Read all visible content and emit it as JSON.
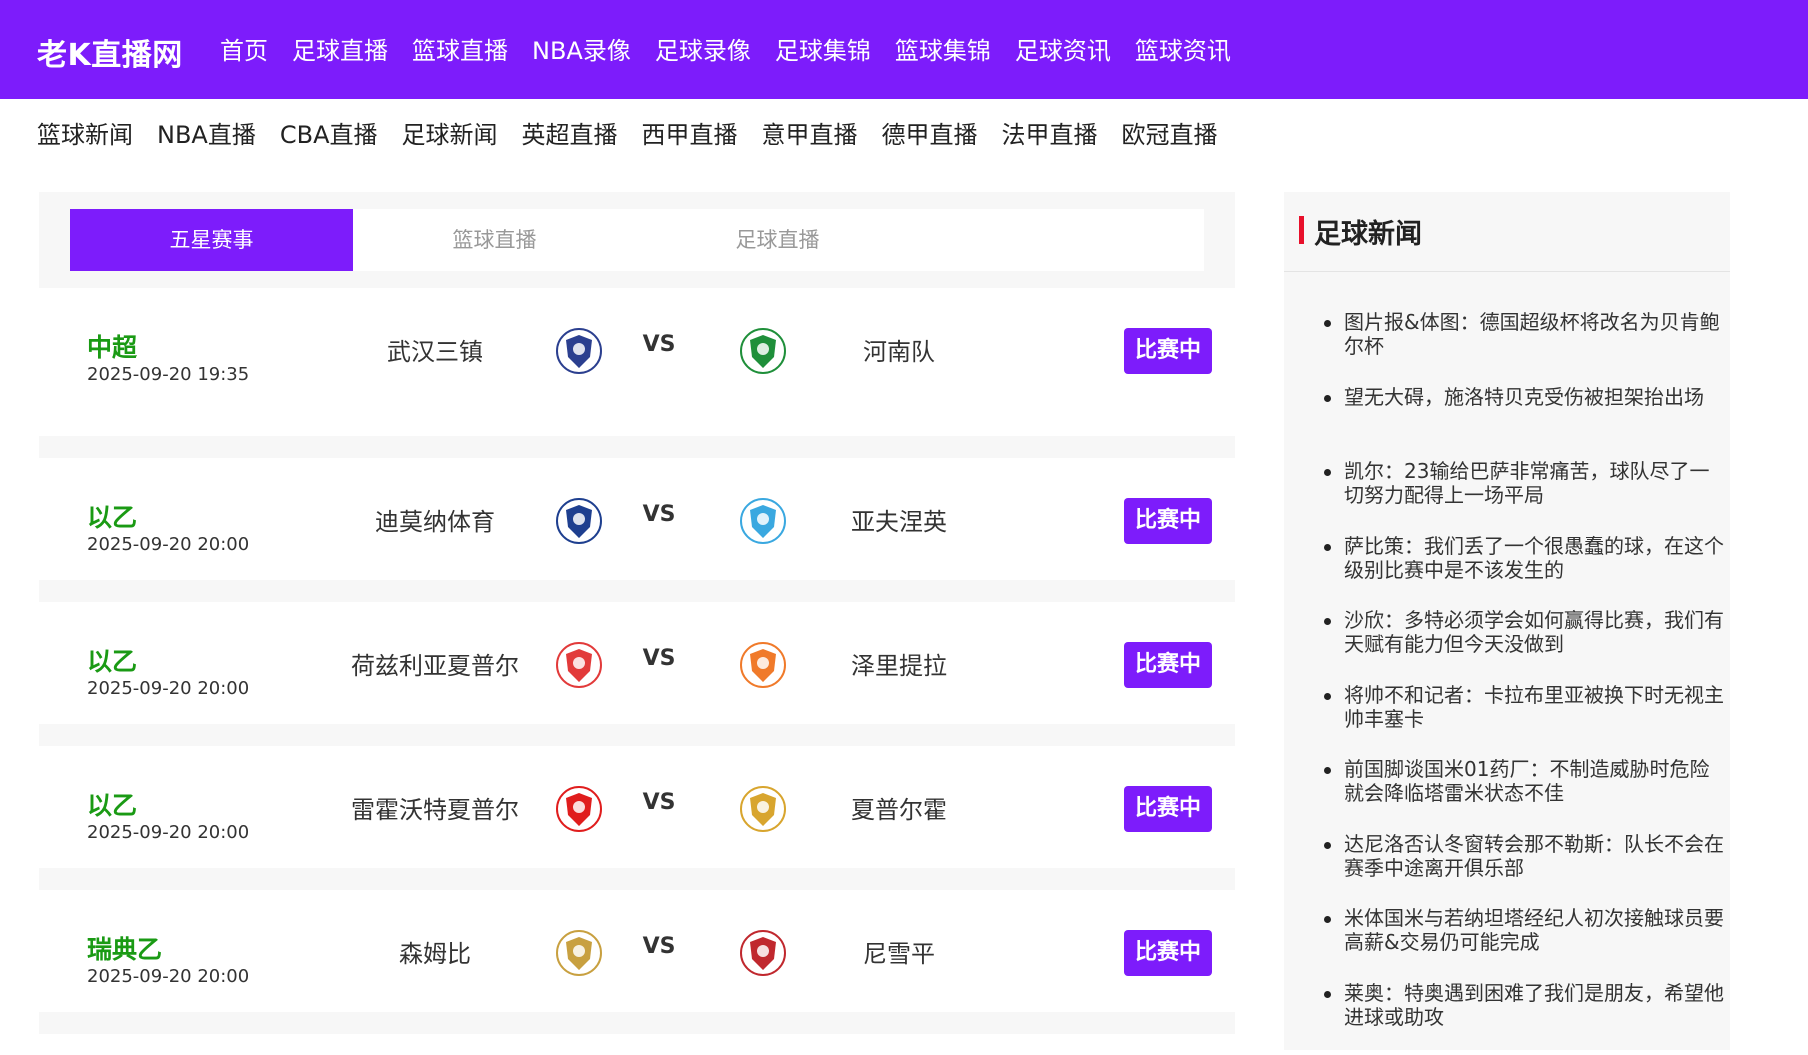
{
  "header": {
    "logo": "老K直播网",
    "nav": [
      "首页",
      "足球直播",
      "篮球直播",
      "NBA录像",
      "足球录像",
      "足球集锦",
      "篮球集锦",
      "足球资讯",
      "篮球资讯"
    ]
  },
  "subnav": [
    "篮球新闻",
    "NBA直播",
    "CBA直播",
    "足球新闻",
    "英超直播",
    "西甲直播",
    "意甲直播",
    "德甲直播",
    "法甲直播",
    "欧冠直播"
  ],
  "tabs": [
    "五星赛事",
    "篮球直播",
    "足球直播"
  ],
  "vs_label": "VS",
  "matches": [
    {
      "league": "中超",
      "time": "2025-09-20 19:35",
      "home": "武汉三镇",
      "away": "河南队",
      "status": "比赛中",
      "home_color": "#2b3f8f",
      "away_color": "#1f8f3a"
    },
    {
      "league": "以乙",
      "time": "2025-09-20 20:00",
      "home": "迪莫纳体育",
      "away": "亚夫涅英",
      "status": "比赛中",
      "home_color": "#1e3f8f",
      "away_color": "#3aa8e0"
    },
    {
      "league": "以乙",
      "time": "2025-09-20 20:00",
      "home": "荷兹利亚夏普尔",
      "away": "泽里提拉",
      "status": "比赛中",
      "home_color": "#e23a3a",
      "away_color": "#f07a2a"
    },
    {
      "league": "以乙",
      "time": "2025-09-20 20:00",
      "home": "雷霍沃特夏普尔",
      "away": "夏普尔霍",
      "status": "比赛中",
      "home_color": "#e01d1d",
      "away_color": "#d8a52e"
    },
    {
      "league": "瑞典乙",
      "time": "2025-09-20 20:00",
      "home": "森姆比",
      "away": "尼雪平",
      "status": "比赛中",
      "home_color": "#c8a040",
      "away_color": "#c0282e"
    }
  ],
  "sidebar": {
    "title": "足球新闻",
    "news": [
      "图片报&体图：德国超级杯将改名为贝肯鲍尔杯",
      "望无大碍，施洛特贝克受伤被担架抬出场",
      "凯尔：23输给巴萨非常痛苦，球队尽了一切努力配得上一场平局",
      "萨比策：我们丢了一个很愚蠢的球，在这个级别比赛中是不该发生的",
      "沙欣：多特必须学会如何赢得比赛，我们有天赋有能力但今天没做到",
      "将帅不和记者：卡拉布里亚被换下时无视主帅丰塞卡",
      "前国脚谈国米01药厂：不制造威胁时危险就会降临塔雷米状态不佳",
      "达尼洛否认冬窗转会那不勒斯：队长不会在赛季中途离开俱乐部",
      "米体国米与若纳坦塔经纪人初次接触球员要高薪&交易仍可能完成",
      "莱奥：特奥遇到困难了我们是朋友，希望他进球或助攻"
    ]
  }
}
